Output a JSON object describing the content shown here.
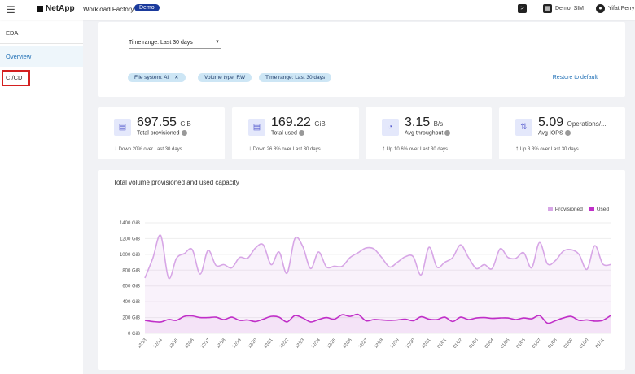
{
  "topbar": {
    "brand": "NetApp",
    "product": "Workload Factory",
    "badge": "Demo",
    "account": "Demo_SIM",
    "user": "Yifat Perry",
    "icons": {
      "menu": "hamburger-icon",
      "terminal": "terminal-icon",
      "account": "building-icon",
      "user": "user-circle-icon"
    }
  },
  "sidebar": {
    "items": [
      {
        "label": "EDA"
      },
      {
        "label": "Overview",
        "active": true
      },
      {
        "label": "CI/CD",
        "highlighted": true
      }
    ]
  },
  "filters": {
    "time_range_select": "Time range: Last 30 days",
    "chips": [
      "File system: All",
      "Volume type: RW",
      "Time range: Last 30 days"
    ],
    "restore": "Restore to default"
  },
  "stats": [
    {
      "value": "697.55",
      "unit": "GiB",
      "label": "Total provisioned",
      "trend": "Down 20% over Last 30 days",
      "direction": "down",
      "icon": "storage-icon"
    },
    {
      "value": "169.22",
      "unit": "GiB",
      "label": "Total used",
      "trend": "Down 26.8% over Last 30 days",
      "direction": "down",
      "icon": "storage-icon"
    },
    {
      "value": "3.15",
      "unit": "B/s",
      "label": "Avg throughput",
      "trend": "Up 10.6% over Last 30 days",
      "direction": "up",
      "icon": "gauge-icon"
    },
    {
      "value": "5.09",
      "unit": "Operations/...",
      "label": "Avg IOPS",
      "trend": "Up 3.3% over Last 30 days",
      "direction": "up",
      "icon": "arrows-updown-icon"
    }
  ],
  "chart_data": {
    "type": "area",
    "title": "Total volume provisioned and used capacity",
    "legend_position": "top-right",
    "grid": true,
    "ylim": [
      0,
      1400
    ],
    "yticks": [
      "0 GiB",
      "200 GiB",
      "400 GiB",
      "600 GiB",
      "800 GiB",
      "1000 GiB",
      "1200 GiB",
      "1400 GiB"
    ],
    "categories": [
      "12/13",
      "12/14",
      "12/15",
      "12/16",
      "12/17",
      "12/18",
      "12/19",
      "12/20",
      "12/21",
      "12/22",
      "12/23",
      "12/24",
      "12/25",
      "12/26",
      "12/27",
      "12/28",
      "12/29",
      "12/30",
      "12/31",
      "01/01",
      "01/02",
      "01/03",
      "01/04",
      "01/05",
      "01/06",
      "01/07",
      "01/08",
      "01/09",
      "01/10",
      "01/11"
    ],
    "series": [
      {
        "name": "Provisioned",
        "color": "#d7a6e6",
        "values": [
          700,
          950,
          1240,
          700,
          950,
          1010,
          1060,
          750,
          1050,
          860,
          870,
          830,
          960,
          950,
          1080,
          1120,
          870,
          1030,
          760,
          1200,
          1100,
          820,
          1030,
          840,
          850,
          850,
          960,
          1020,
          1080,
          1070,
          960,
          840,
          900,
          970,
          970,
          740,
          1090,
          840,
          900,
          960,
          1120,
          960,
          820,
          870,
          820,
          1070,
          960,
          950,
          1020,
          830,
          1150,
          880,
          920,
          1040,
          1060,
          1000,
          810,
          1110,
          880,
          870
        ]
      },
      {
        "name": "Used",
        "color": "#c02fc8",
        "values": [
          165,
          150,
          145,
          175,
          165,
          215,
          220,
          200,
          200,
          205,
          175,
          205,
          165,
          170,
          150,
          180,
          215,
          205,
          145,
          225,
          195,
          145,
          175,
          200,
          180,
          235,
          215,
          240,
          160,
          175,
          170,
          165,
          170,
          180,
          160,
          210,
          180,
          175,
          205,
          150,
          205,
          175,
          195,
          200,
          190,
          195,
          195,
          175,
          195,
          185,
          225,
          130,
          160,
          195,
          215,
          165,
          170,
          155,
          165,
          225
        ]
      }
    ]
  }
}
